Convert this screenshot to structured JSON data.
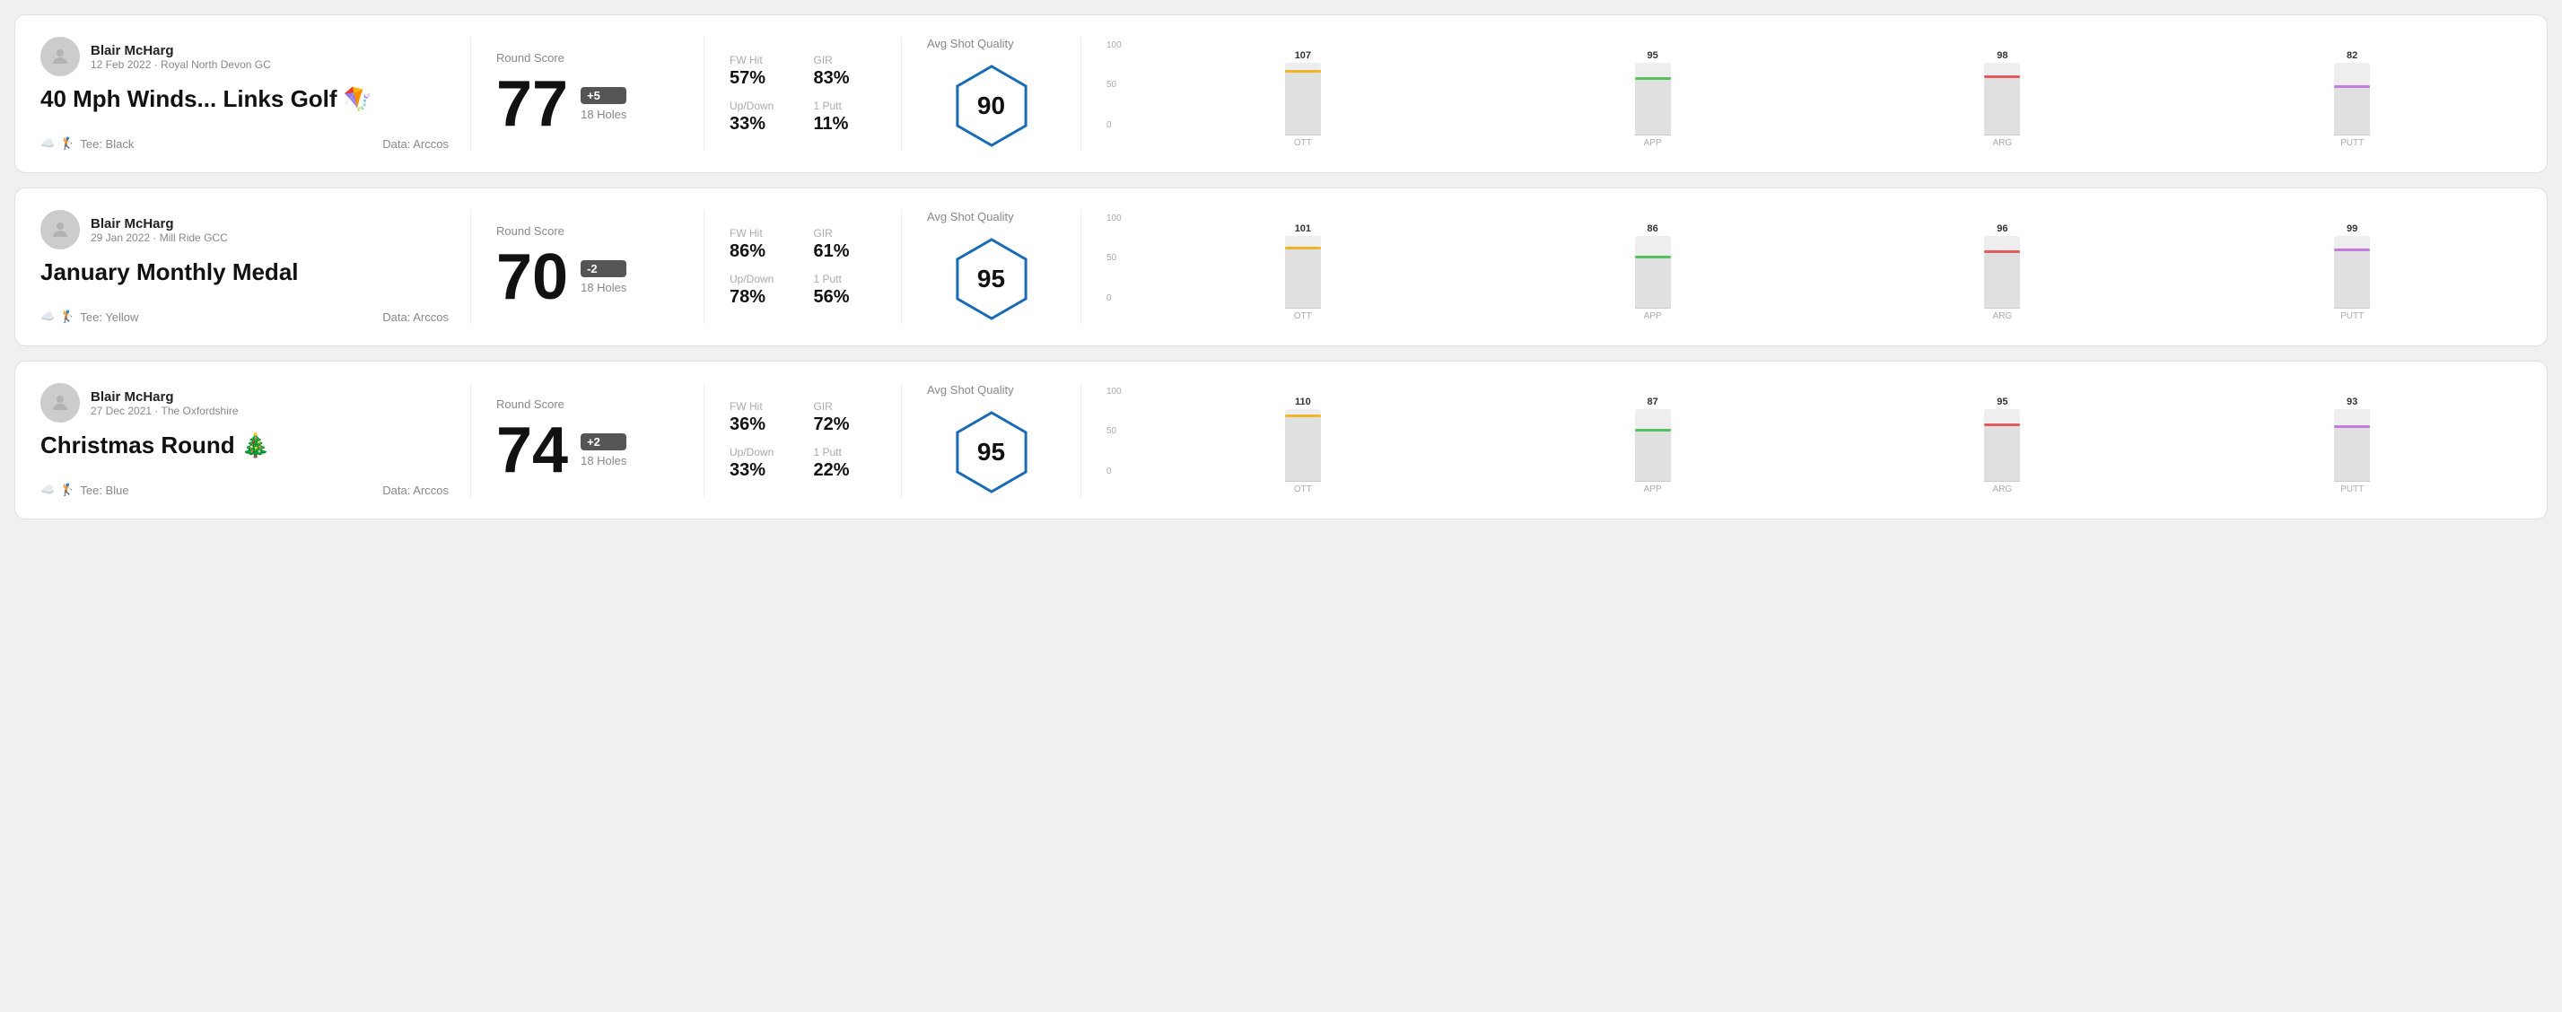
{
  "rounds": [
    {
      "id": "round1",
      "user_name": "Blair McHarg",
      "user_meta": "12 Feb 2022 · Royal North Devon GC",
      "round_title": "40 Mph Winds... Links Golf 🪁",
      "tee": "Tee: Black",
      "data_source": "Data: Arccos",
      "round_score_label": "Round Score",
      "score": "77",
      "score_badge": "+5",
      "holes": "18 Holes",
      "fw_hit_label": "FW Hit",
      "fw_hit_value": "57%",
      "gir_label": "GIR",
      "gir_value": "83%",
      "updown_label": "Up/Down",
      "updown_value": "33%",
      "one_putt_label": "1 Putt",
      "one_putt_value": "11%",
      "quality_label": "Avg Shot Quality",
      "quality_score": "90",
      "chart_bars": [
        {
          "label": "OTT",
          "value": 107,
          "color": "#f0b429"
        },
        {
          "label": "APP",
          "value": 95,
          "color": "#56c25b"
        },
        {
          "label": "ARG",
          "value": 98,
          "color": "#e05c5c"
        },
        {
          "label": "PUTT",
          "value": 82,
          "color": "#c47be0"
        }
      ]
    },
    {
      "id": "round2",
      "user_name": "Blair McHarg",
      "user_meta": "29 Jan 2022 · Mill Ride GCC",
      "round_title": "January Monthly Medal",
      "tee": "Tee: Yellow",
      "data_source": "Data: Arccos",
      "round_score_label": "Round Score",
      "score": "70",
      "score_badge": "-2",
      "holes": "18 Holes",
      "fw_hit_label": "FW Hit",
      "fw_hit_value": "86%",
      "gir_label": "GIR",
      "gir_value": "61%",
      "updown_label": "Up/Down",
      "updown_value": "78%",
      "one_putt_label": "1 Putt",
      "one_putt_value": "56%",
      "quality_label": "Avg Shot Quality",
      "quality_score": "95",
      "chart_bars": [
        {
          "label": "OTT",
          "value": 101,
          "color": "#f0b429"
        },
        {
          "label": "APP",
          "value": 86,
          "color": "#56c25b"
        },
        {
          "label": "ARG",
          "value": 96,
          "color": "#e05c5c"
        },
        {
          "label": "PUTT",
          "value": 99,
          "color": "#c47be0"
        }
      ]
    },
    {
      "id": "round3",
      "user_name": "Blair McHarg",
      "user_meta": "27 Dec 2021 · The Oxfordshire",
      "round_title": "Christmas Round 🎄",
      "tee": "Tee: Blue",
      "data_source": "Data: Arccos",
      "round_score_label": "Round Score",
      "score": "74",
      "score_badge": "+2",
      "holes": "18 Holes",
      "fw_hit_label": "FW Hit",
      "fw_hit_value": "36%",
      "gir_label": "GIR",
      "gir_value": "72%",
      "updown_label": "Up/Down",
      "updown_value": "33%",
      "one_putt_label": "1 Putt",
      "one_putt_value": "22%",
      "quality_label": "Avg Shot Quality",
      "quality_score": "95",
      "chart_bars": [
        {
          "label": "OTT",
          "value": 110,
          "color": "#f0b429"
        },
        {
          "label": "APP",
          "value": 87,
          "color": "#56c25b"
        },
        {
          "label": "ARG",
          "value": 95,
          "color": "#e05c5c"
        },
        {
          "label": "PUTT",
          "value": 93,
          "color": "#c47be0"
        }
      ]
    }
  ]
}
